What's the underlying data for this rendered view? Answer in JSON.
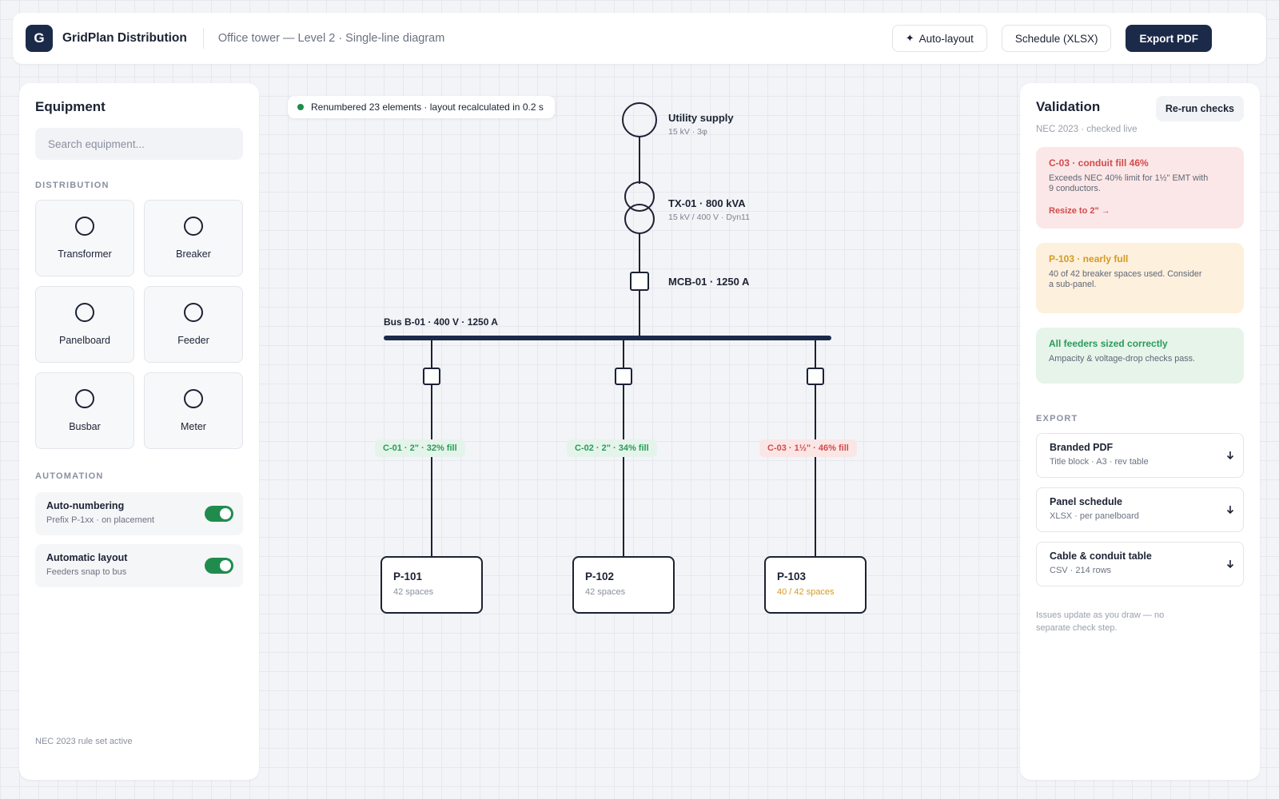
{
  "app": {
    "logo_letter": "G",
    "name": "GridPlan Distribution",
    "doc_title": "Office tower — Level 2 · Single-line diagram"
  },
  "toolbar": {
    "auto_layout_icon": "sparkle-icon",
    "auto_layout_glyph": "✦",
    "auto_layout": "Auto-layout",
    "schedule": "Schedule (XLSX)",
    "export_pdf": "Export PDF"
  },
  "equipment": {
    "title": "Equipment",
    "search_placeholder": "Search equipment...",
    "distribution_label": "DISTRIBUTION",
    "items": [
      {
        "label": "Transformer",
        "icon": "circle-icon"
      },
      {
        "label": "Breaker",
        "icon": "circle-icon"
      },
      {
        "label": "Panelboard",
        "icon": "circle-icon"
      },
      {
        "label": "Feeder",
        "icon": "circle-icon"
      },
      {
        "label": "Busbar",
        "icon": "circle-icon"
      },
      {
        "label": "Meter",
        "icon": "circle-icon"
      }
    ],
    "automation_label": "AUTOMATION",
    "toggles": [
      {
        "title": "Auto-numbering",
        "sub": "Prefix P-1xx · on placement",
        "on": true
      },
      {
        "title": "Automatic layout",
        "sub": "Feeders snap to bus",
        "on": true
      }
    ],
    "footer": "NEC 2023 rule set active"
  },
  "canvas": {
    "toast": "Renumbered 23 elements · layout recalculated in 0.2 s",
    "utility": {
      "title": "Utility supply",
      "sub": "15 kV · 3φ"
    },
    "transformer": {
      "title": "TX-01 · 800 kVA",
      "sub": "15 kV / 400 V · Dyn11"
    },
    "main_breaker": {
      "title": "MCB-01 · 1250 A"
    },
    "bus": {
      "label": "Bus B-01 · 400 V · 1250 A"
    },
    "feeders": [
      {
        "conduit": "C-01 · 2\" · 32% fill",
        "status": "ok",
        "panel": "P-101",
        "spaces": "42 spaces",
        "spaces_status": "normal"
      },
      {
        "conduit": "C-02 · 2\" · 34% fill",
        "status": "ok",
        "panel": "P-102",
        "spaces": "42 spaces",
        "spaces_status": "normal"
      },
      {
        "conduit": "C-03 · 1½\" · 46% fill",
        "status": "error",
        "panel": "P-103",
        "spaces": "40 / 42 spaces",
        "spaces_status": "warning"
      }
    ]
  },
  "validation": {
    "title": "Validation",
    "rerun": "Re-run checks",
    "sub": "NEC 2023 · checked live",
    "issues": [
      {
        "title": "C-03 · conduit fill 46%",
        "text": "Exceeds NEC 40% limit for 1½\" EMT with 9 conductors.",
        "action": "Resize to 2\" →",
        "severity": "error"
      },
      {
        "title": "P-103 · nearly full",
        "text": "40 of 42 breaker spaces used. Consider a sub-panel.",
        "severity": "warning"
      },
      {
        "title": "All feeders sized correctly",
        "text": "Ampacity & voltage-drop checks pass.",
        "severity": "ok"
      }
    ],
    "export_label": "EXPORT",
    "exports": [
      {
        "title": "Branded PDF",
        "sub": "Title block · A3 · rev table",
        "icon": "download-icon"
      },
      {
        "title": "Panel schedule",
        "sub": "XLSX · per panelboard",
        "icon": "download-icon"
      },
      {
        "title": "Cable & conduit table",
        "sub": "CSV · 214 rows",
        "icon": "download-icon"
      }
    ],
    "footer": "Issues update as you draw — no separate check step."
  },
  "colors": {
    "brand": "#1c2a4a",
    "ok": "#2a9a5a",
    "error": "#d24b4b",
    "warning": "#d69a22",
    "toggle_on": "#1f8c4e"
  }
}
